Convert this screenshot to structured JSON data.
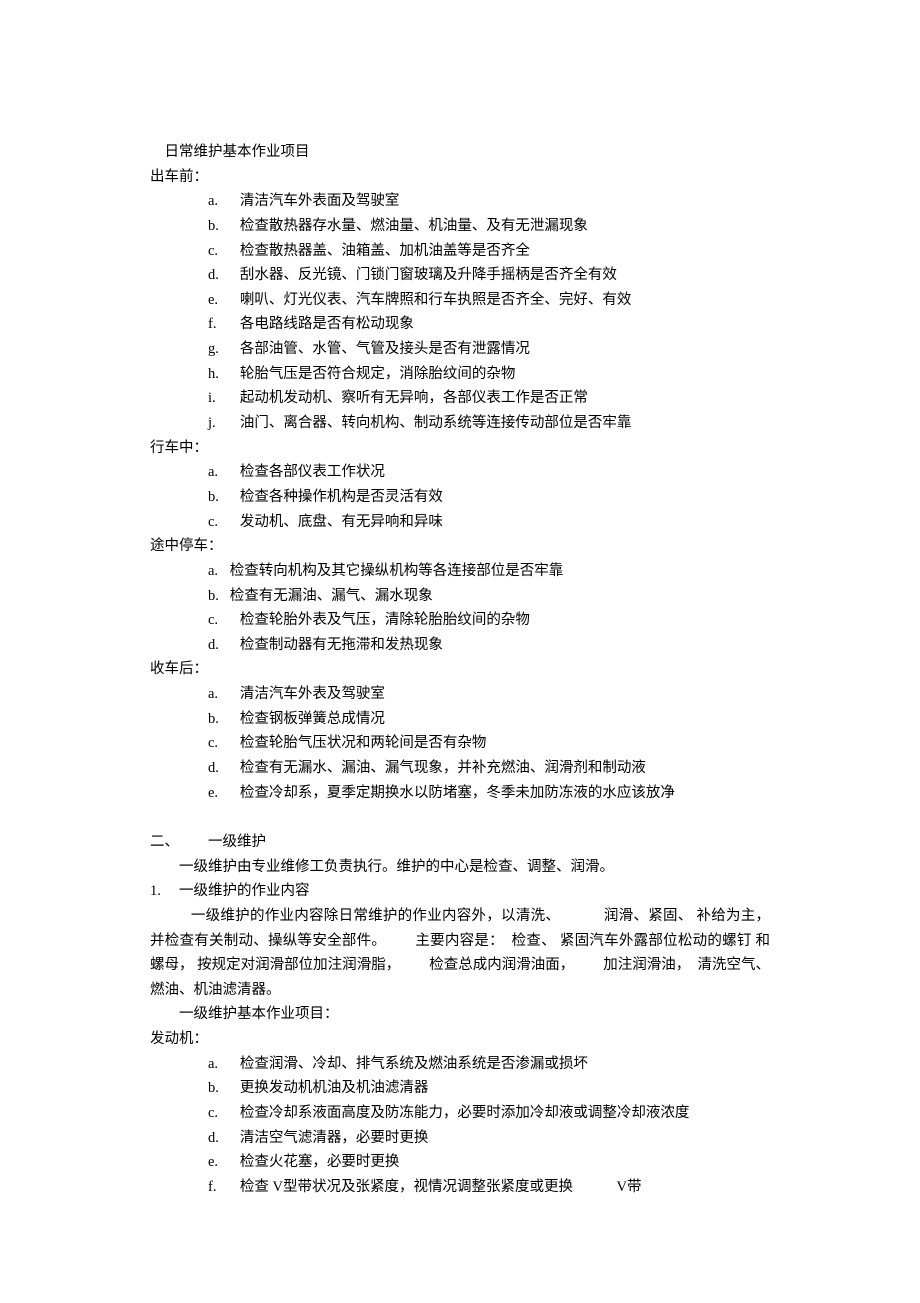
{
  "title": "日常维护基本作业项目",
  "sections": {
    "before": {
      "heading": "出车前：",
      "items": [
        {
          "m": "a.",
          "t": "清洁汽车外表面及驾驶室"
        },
        {
          "m": "b.",
          "t": "检查散热器存水量、燃油量、机油量、及有无泄漏现象"
        },
        {
          "m": "c.",
          "t": "检查散热器盖、油箱盖、加机油盖等是否齐全"
        },
        {
          "m": "d.",
          "t": "刮水器、反光镜、门锁门窗玻璃及升降手摇柄是否齐全有效"
        },
        {
          "m": "e.",
          "t": "喇叭、灯光仪表、汽车牌照和行车执照是否齐全、完好、有效"
        },
        {
          "m": "f.",
          "t": "各电路线路是否有松动现象"
        },
        {
          "m": "g.",
          "t": "各部油管、水管、气管及接头是否有泄露情况"
        },
        {
          "m": "h.",
          "t": "轮胎气压是否符合规定，消除胎纹间的杂物"
        },
        {
          "m": "i.",
          "t": "起动机发动机、察听有无异响，各部仪表工作是否正常"
        },
        {
          "m": "j.",
          "t": "油门、离合器、转向机构、制动系统等连接传动部位是否牢靠"
        }
      ]
    },
    "driving": {
      "heading": "行车中：",
      "items": [
        {
          "m": "a.",
          "t": "检查各部仪表工作状况"
        },
        {
          "m": "b.",
          "t": "检查各种操作机构是否灵活有效"
        },
        {
          "m": "c.",
          "t": "发动机、底盘、有无异响和异味"
        }
      ]
    },
    "stop": {
      "heading": "途中停车：",
      "items": [
        {
          "m": "a.",
          "t": "检查转向机构及其它操纵机构等各连接部位是否牢靠"
        },
        {
          "m": "b.",
          "t": "检查有无漏油、漏气、漏水现象"
        },
        {
          "m": "c.",
          "t": "检查轮胎外表及气压，清除轮胎胎纹间的杂物"
        },
        {
          "m": "d.",
          "t": "检查制动器有无拖滞和发热现象"
        }
      ]
    },
    "after": {
      "heading": "收车后：",
      "items": [
        {
          "m": "a.",
          "t": "清洁汽车外表及驾驶室"
        },
        {
          "m": "b.",
          "t": "检查钢板弹簧总成情况"
        },
        {
          "m": "c.",
          "t": "检查轮胎气压状况和两轮间是否有杂物"
        },
        {
          "m": "d.",
          "t": "检查有无漏水、漏油、漏气现象，并补充燃油、润滑剂和制动液"
        },
        {
          "m": "e.",
          "t": "检查冷却系，夏季定期换水以防堵塞，冬季未加防冻液的水应该放净"
        }
      ]
    }
  },
  "level1": {
    "num": "二、",
    "title": "一级维护",
    "intro": "一级维护由专业维修工负责执行。维护的中心是检查、调整、润滑。",
    "sub_num": "1.",
    "sub_title": "一级维护的作业内容",
    "body_parts": [
      "一级维护的作业内容除日常维护的作业内容外，以清洗、",
      "润滑、紧固、",
      "补给为主，",
      "并检查有关制动、操纵等安全部件。",
      "主要内容是：",
      "检查、",
      "紧固汽车外露部位松动的螺钉",
      "和螺母，",
      "按规定对润滑部位加注润滑脂，",
      "检查总成内润滑油面，",
      "加注润滑油，",
      "清洗空气、",
      "燃油、机油滤清器。"
    ],
    "list_heading": "一级维护基本作业项目：",
    "engine_heading": "发动机：",
    "engine_items": [
      {
        "m": "a.",
        "t": "检查润滑、冷却、排气系统及燃油系统是否渗漏或损坏"
      },
      {
        "m": "b.",
        "t": "更换发动机机油及机油滤清器"
      },
      {
        "m": "c.",
        "t": "检查冷却系液面高度及防冻能力，必要时添加冷却液或调整冷却液浓度"
      },
      {
        "m": "d.",
        "t": "清洁空气滤清器，必要时更换"
      },
      {
        "m": "e.",
        "t": "检查火花塞，必要时更换"
      }
    ],
    "vbelt": {
      "m": "f.",
      "before": "检查 ",
      "v1": "V",
      "mid": "型带状况及张紧度，视情况调整张紧度或更换",
      "v2": "V",
      "after": "带"
    }
  }
}
